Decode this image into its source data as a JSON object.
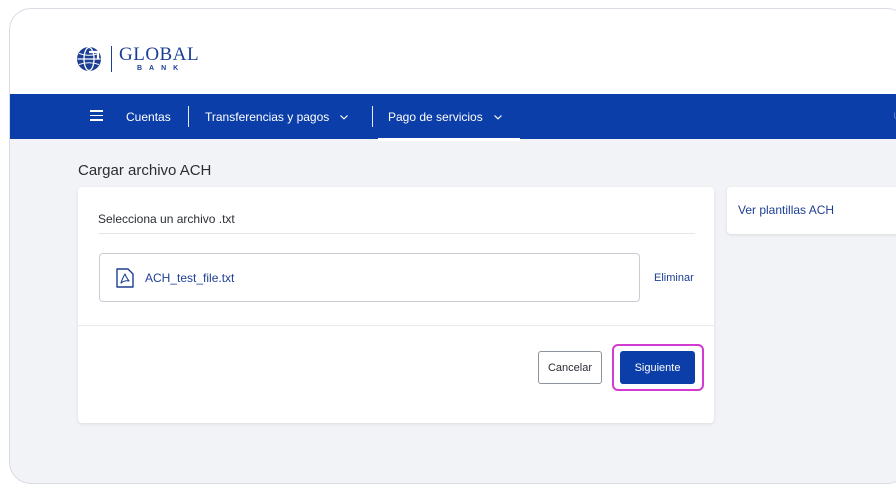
{
  "brand": {
    "name": "GLOBAL",
    "subtitle": "BANK",
    "logo_icon": "globe-icon",
    "color": "#1c3f94"
  },
  "nav": {
    "background": "#0b3ea8",
    "menu_icon": "hamburger-icon",
    "items": [
      {
        "label": "Cuentas",
        "has_dropdown": false
      },
      {
        "label": "Transferencias y pagos",
        "has_dropdown": true
      },
      {
        "label": "Pago de servicios",
        "has_dropdown": true,
        "active": true
      }
    ],
    "edge_text": "U"
  },
  "page": {
    "title": "Cargar archivo ACH"
  },
  "upload": {
    "label": "Selecciona un archivo .txt",
    "file_name": "ACH_test_file.txt",
    "file_icon": "pdf-file-icon",
    "remove_label": "Eliminar"
  },
  "actions": {
    "cancel_label": "Cancelar",
    "next_label": "Siguiente",
    "highlight_color": "#d23ad2"
  },
  "sidebar": {
    "templates_link": "Ver plantillas ACH"
  }
}
